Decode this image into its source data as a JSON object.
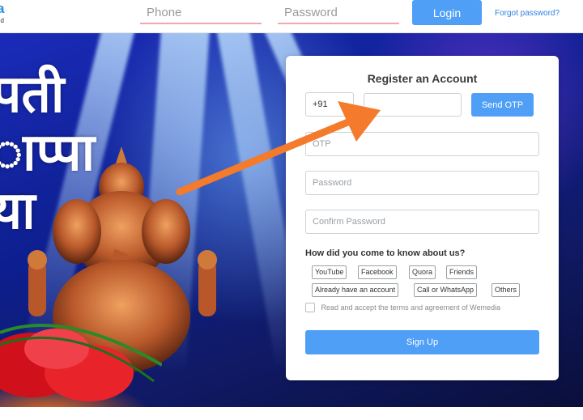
{
  "header": {
    "logo_text": "a",
    "logo_subtext": "nd",
    "phone_placeholder": "Phone",
    "password_placeholder": "Password",
    "login_label": "Login",
    "forgot_label": "Forgot password?"
  },
  "hero": {
    "marathi_line1": "पती",
    "marathi_line2": "ाप्पा",
    "marathi_line3": "या"
  },
  "register": {
    "title": "Register an Account",
    "country_code": "+91",
    "phone_value": "",
    "send_otp_label": "Send OTP",
    "otp_placeholder": "OTP",
    "password_placeholder": "Password",
    "confirm_password_placeholder": "Confirm Password",
    "question": "How did you come to know about us?",
    "sources": [
      "YouTube",
      "Facebook",
      "Quora",
      "Friends",
      "Already have an account",
      "Call or WhatsApp",
      "Others"
    ],
    "terms_text": "Read and accept the terms and agreement of Wemedia",
    "signup_label": "Sign Up"
  },
  "colors": {
    "primary_button": "#4f9ff7",
    "annotation_arrow": "#f47a2c",
    "link": "#2d7fe0"
  }
}
